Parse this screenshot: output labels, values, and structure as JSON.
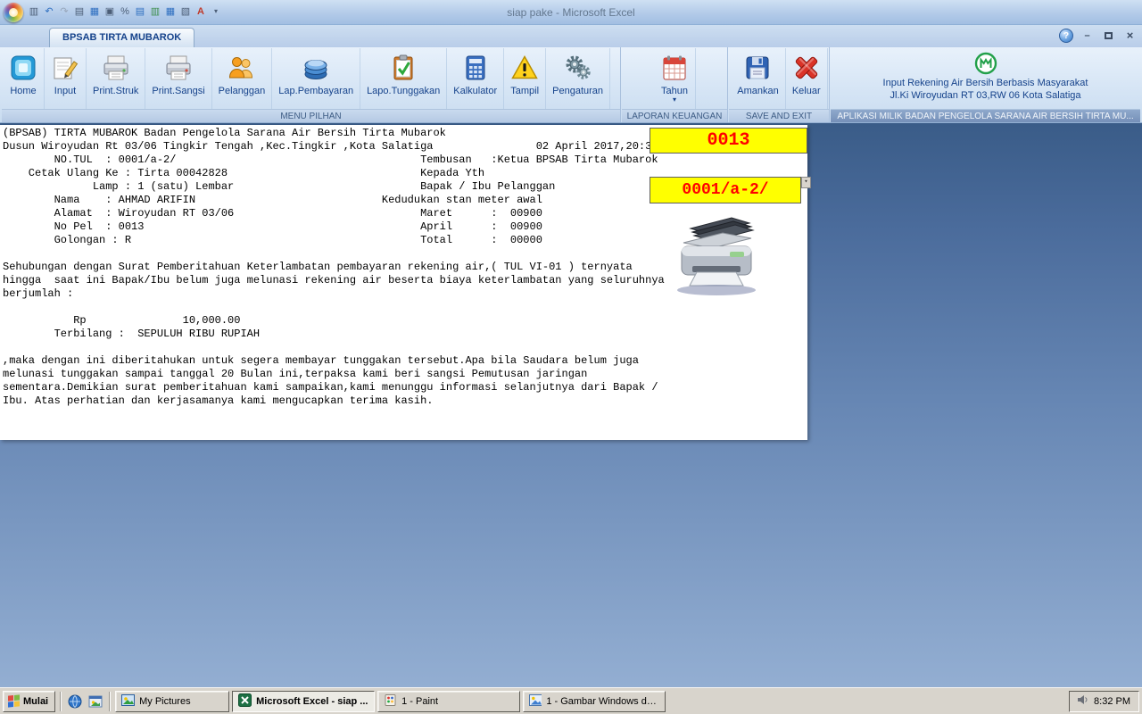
{
  "window": {
    "title": "siap pake - Microsoft Excel",
    "controls": {
      "help": "?",
      "minimize": "–",
      "close": "×"
    }
  },
  "qat": [
    {
      "name": "paste-icon",
      "glyph": "▥"
    },
    {
      "name": "undo-icon",
      "glyph": "↶"
    },
    {
      "name": "redo-icon",
      "glyph": "↷"
    },
    {
      "name": "print-preview-icon",
      "glyph": "▤"
    },
    {
      "name": "save-icon",
      "glyph": "▦"
    },
    {
      "name": "print-icon",
      "glyph": "▣"
    },
    {
      "name": "percent-icon",
      "glyph": "%"
    },
    {
      "name": "sheet-1-icon",
      "glyph": "▤"
    },
    {
      "name": "sheet-2-icon",
      "glyph": "▥"
    },
    {
      "name": "sheet-3-icon",
      "glyph": "▦"
    },
    {
      "name": "sheet-4-icon",
      "glyph": "▧"
    },
    {
      "name": "font-color-icon",
      "glyph": "A"
    },
    {
      "name": "qat-customize-icon",
      "glyph": "▾"
    }
  ],
  "tab": {
    "label": "BPSAB TIRTA MUBAROK"
  },
  "ribbon": {
    "groups": [
      {
        "label": "MENU PILHAN",
        "buttons": [
          {
            "label": "Home"
          },
          {
            "label": "Input"
          },
          {
            "label": "Print.Struk"
          },
          {
            "label": "Print.Sangsi"
          },
          {
            "label": "Pelanggan"
          },
          {
            "label": "Lap.Pembayaran"
          },
          {
            "label": "Lapo.Tunggakan"
          },
          {
            "label": "Kalkulator"
          },
          {
            "label": "Tampil"
          },
          {
            "label": "Pengaturan"
          }
        ]
      },
      {
        "label": "LAPORAN KEUANGAN",
        "buttons": [
          {
            "label": "Tahun",
            "dropdown": "▾"
          }
        ]
      },
      {
        "label": "SAVE AND EXIT",
        "buttons": [
          {
            "label": "Amankan"
          },
          {
            "label": "Keluar"
          }
        ]
      },
      {
        "label": "APLIKASI MILIK BADAN PENGELOLA SARANA AIR BERSIH TIRTA MU...",
        "info_line1": "Input Rekening Air Bersih Berbasis Masyarakat",
        "info_line2": "Jl.Ki Wiroyudan RT 03,RW 06 Kota Salatiga"
      }
    ]
  },
  "doc": {
    "no_pel_badge": "0013",
    "no_tul_badge": "0001/a-2/",
    "dropdown_glyph": "▾",
    "lines": [
      "(BPSAB) TIRTA MUBAROK Badan Pengelola Sarana Air Bersih Tirta Mubarok",
      "Dusun Wiroyudan Rt 03/06 Tingkir Tengah ,Kec.Tingkir ,Kota Salatiga                02 April 2017,20:32",
      "        NO.TUL  : 0001/a-2/                                      Tembusan   :Ketua BPSAB Tirta Mubarok",
      "    Cetak Ulang Ke : Tirta 00042828                              Kepada Yth",
      "              Lamp : 1 (satu) Lembar                             Bapak / Ibu Pelanggan",
      "        Nama    : AHMAD ARIFIN                             Kedudukan stan meter awal",
      "        Alamat  : Wiroyudan RT 03/06                             Maret      :  00900",
      "        No Pel  : 0013                                           April      :  00900",
      "        Golongan : R                                             Total      :  00000",
      "",
      "Sehubungan dengan Surat Pemberitahuan Keterlambatan pembayaran rekening air,( TUL VI-01 ) ternyata",
      "hingga  saat ini Bapak/Ibu belum juga melunasi rekening air beserta biaya keterlambatan yang seluruhnya",
      "berjumlah :",
      "",
      "           Rp               10,000.00",
      "        Terbilang :  SEPULUH RIBU RUPIAH",
      "",
      ",maka dengan ini diberitahukan untuk segera membayar tunggakan tersebut.Apa bila Saudara belum juga",
      "melunasi tunggakan sampai tanggal 20 Bulan ini,terpaksa kami beri sangsi Pemutusan jaringan",
      "sementara.Demikian surat pemberitahuan kami sampaikan,kami menunggu informasi selanjutnya dari Bapak /",
      "Ibu. Atas perhatian dan kerjasamanya kami mengucapkan terima kasih."
    ]
  },
  "taskbar": {
    "start_label": "Mulai",
    "tasks": [
      {
        "label": "My Pictures"
      },
      {
        "label": "Microsoft Excel - siap ..."
      },
      {
        "label": "1 - Paint"
      },
      {
        "label": "1 - Gambar Windows dan..."
      }
    ],
    "clock": "8:32 PM"
  }
}
